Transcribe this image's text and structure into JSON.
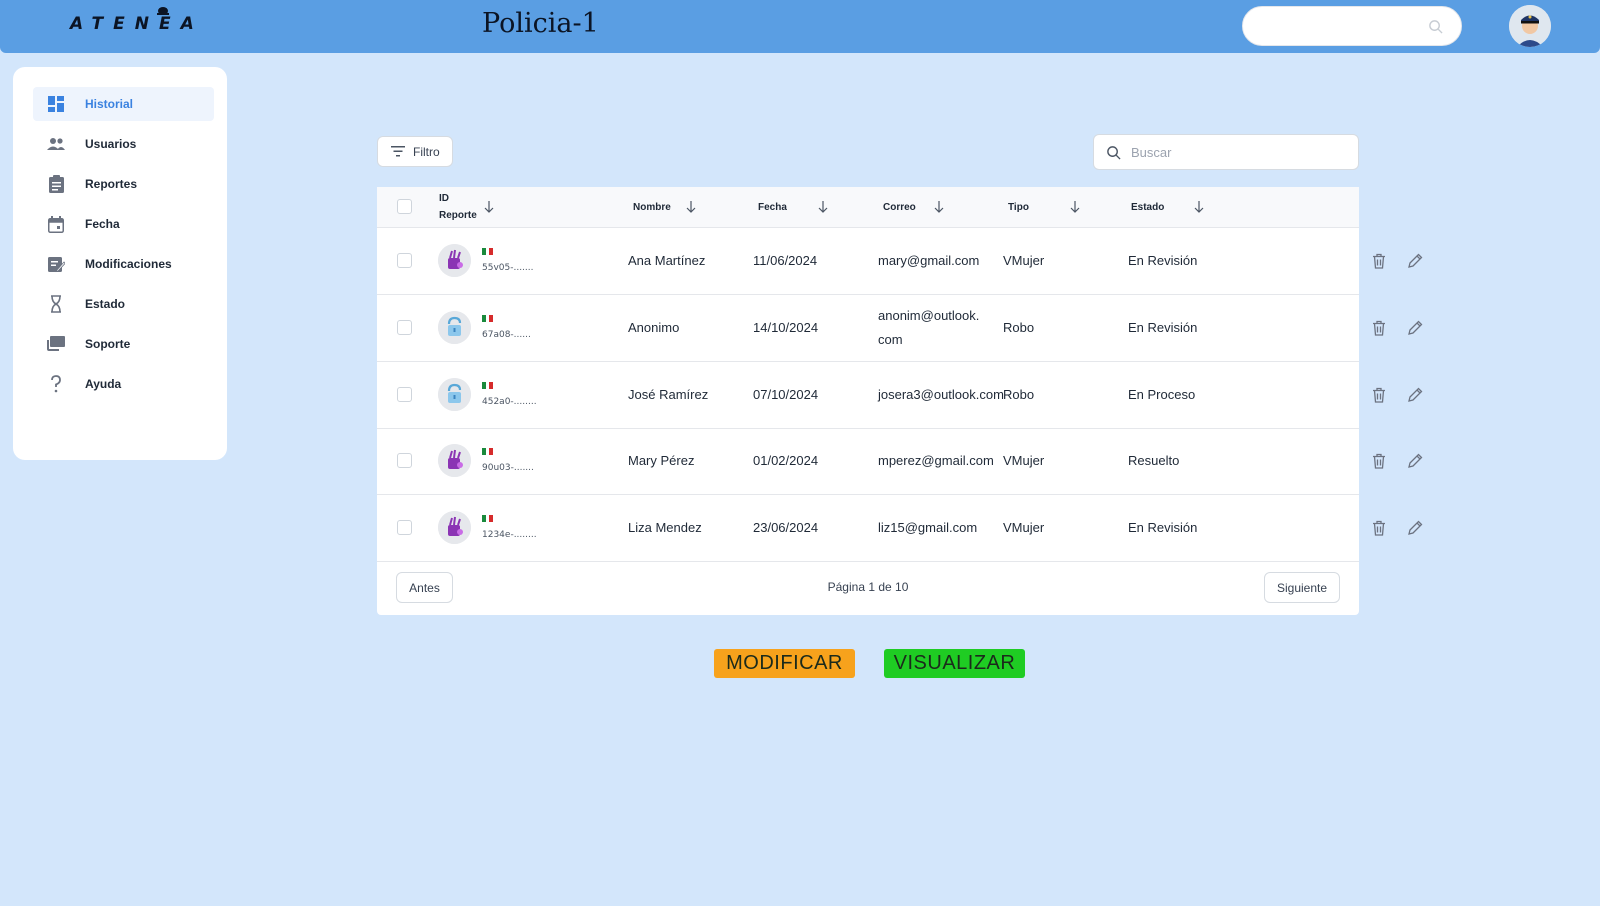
{
  "header": {
    "logo": "ATENEA",
    "title": "Policia-1",
    "search_placeholder": ""
  },
  "sidebar": {
    "items": [
      {
        "label": "Historial",
        "icon": "dashboard-icon",
        "active": true
      },
      {
        "label": "Usuarios",
        "icon": "users-icon",
        "active": false
      },
      {
        "label": "Reportes",
        "icon": "clipboard-icon",
        "active": false
      },
      {
        "label": "Fecha",
        "icon": "calendar-icon",
        "active": false
      },
      {
        "label": "Modificaciones",
        "icon": "edit-note-icon",
        "active": false
      },
      {
        "label": "Estado",
        "icon": "hourglass-icon",
        "active": false
      },
      {
        "label": "Soporte",
        "icon": "chat-icon",
        "active": false
      },
      {
        "label": "Ayuda",
        "icon": "question-icon",
        "active": false
      }
    ]
  },
  "toolbar": {
    "filter_label": "Filtro",
    "search_placeholder": "Buscar"
  },
  "table": {
    "headers": {
      "id_line1": "ID",
      "id_line2": "Reporte",
      "nombre": "Nombre",
      "fecha": "Fecha",
      "correo": "Correo",
      "tipo": "Tipo",
      "estado": "Estado"
    },
    "rows": [
      {
        "avatar": "purple",
        "id": "55v05-.......",
        "nombre": "Ana Martínez",
        "fecha": "11/06/2024",
        "correo_line1": "mary@gmail.com",
        "correo_line2": "",
        "tipo": "VMujer",
        "estado": "En Revisión"
      },
      {
        "avatar": "blue",
        "id": "67a08-......",
        "nombre": "Anonimo",
        "fecha": "14/10/2024",
        "correo_line1": "anonim@outlook.",
        "correo_line2": "com",
        "tipo": "Robo",
        "estado": "En Revisión"
      },
      {
        "avatar": "blue",
        "id": "452a0-........",
        "nombre": "José Ramírez",
        "fecha": "07/10/2024",
        "correo_line1": "josera3@outlook.com",
        "correo_line2": "",
        "tipo": "Robo",
        "estado": "En Proceso"
      },
      {
        "avatar": "purple",
        "id": "90u03-.......",
        "nombre": "Mary Pérez",
        "fecha": "01/02/2024",
        "correo_line1": "mperez@gmail.com",
        "correo_line2": "",
        "tipo": "VMujer",
        "estado": "Resuelto"
      },
      {
        "avatar": "purple",
        "id": "1234e-........",
        "nombre": "Liza Mendez",
        "fecha": "23/06/2024",
        "correo_line1": "liz15@gmail.com",
        "correo_line2": "",
        "tipo": "VMujer",
        "estado": "En Revisión"
      }
    ],
    "pagination": {
      "prev": "Antes",
      "info": "Página 1 de 10",
      "next": "Siguiente"
    }
  },
  "actions": {
    "modify": "MODIFICAR",
    "view": "VISUALIZAR"
  },
  "colors": {
    "background": "#d3e6fb",
    "topbar": "#5a9ee3",
    "accent": "#3a82e0",
    "modify": "#f7a21c",
    "view": "#1fcc23"
  }
}
